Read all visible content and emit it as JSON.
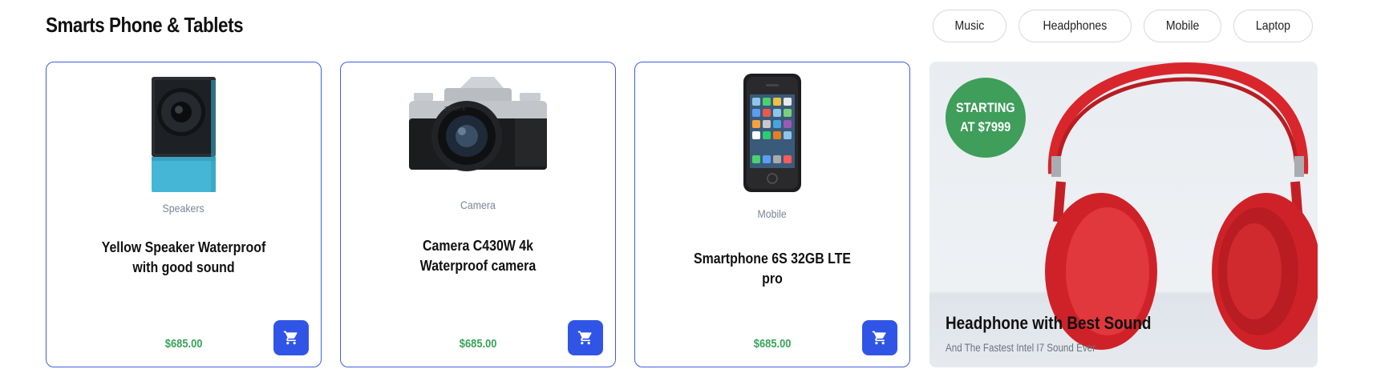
{
  "section": {
    "title": "Smarts Phone & Tablets"
  },
  "filters": [
    "Music",
    "Headphones",
    "Mobile",
    "Laptop"
  ],
  "products": [
    {
      "category": "Speakers",
      "name": "Yellow Speaker Waterproof with good sound",
      "price": "$685.00",
      "image": "speaker-image"
    },
    {
      "category": "Camera",
      "name": "Camera C430W 4k Waterproof camera",
      "price": "$685.00",
      "image": "camera-image"
    },
    {
      "category": "Mobile",
      "name": "Smartphone 6S 32GB LTE pro",
      "price": "$685.00",
      "image": "smartphone-image"
    }
  ],
  "promo": {
    "badge_line1": "STARTING",
    "badge_line2": "AT $7999",
    "title": "Headphone with Best Sound",
    "subtitle": "And The Fastest Intel I7 Sound Ever",
    "image": "headphones-image"
  },
  "colors": {
    "accent": "#3055e6",
    "card_border": "#3d5fe0",
    "price": "#3aa35a",
    "badge": "#3e9e5a"
  },
  "icons": {
    "cart": "cart-icon"
  }
}
